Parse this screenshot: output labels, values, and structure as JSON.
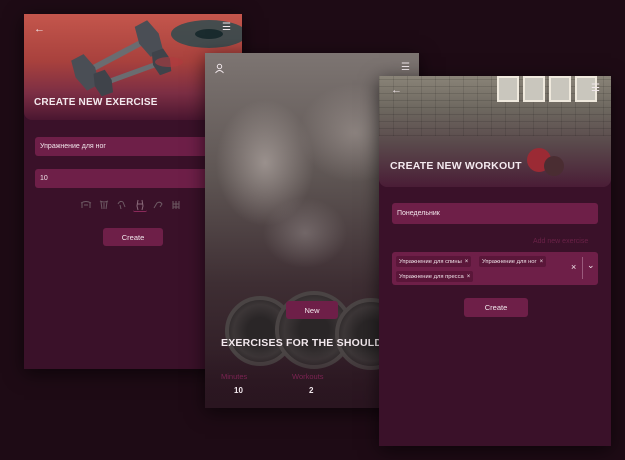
{
  "create_exercise": {
    "title": "CREATE NEW EXERCISE",
    "name_value": "Упражнение для ног",
    "reps_value": "10",
    "button_label": "Create",
    "back_icon": "←",
    "menu_icon": "☰"
  },
  "exercises_list": {
    "profile_icon": "profile-icon",
    "menu_icon": "☰",
    "new_button_label": "New",
    "title": "EXERCISES FOR THE SHOULD",
    "stats": [
      {
        "label": "Minutes",
        "value": "10"
      },
      {
        "label": "Workouts",
        "value": "2"
      }
    ]
  },
  "create_workout": {
    "title": "CREATE NEW WORKOUT",
    "name_value": "Понедельник",
    "add_link": "Add new exercise",
    "tags": [
      "Упражнение для спины",
      "Упражнение для ног",
      "Упражнение для пресса"
    ],
    "tag_remove": "×",
    "clear_icon": "×",
    "dropdown_icon": "⌄",
    "button_label": "Create",
    "back_icon": "←",
    "menu_icon": "☰"
  },
  "colors": {
    "background": "#1e0b15",
    "screen": "#3a1129",
    "field": "#6e1f48",
    "accent_text": "#7b2352"
  }
}
